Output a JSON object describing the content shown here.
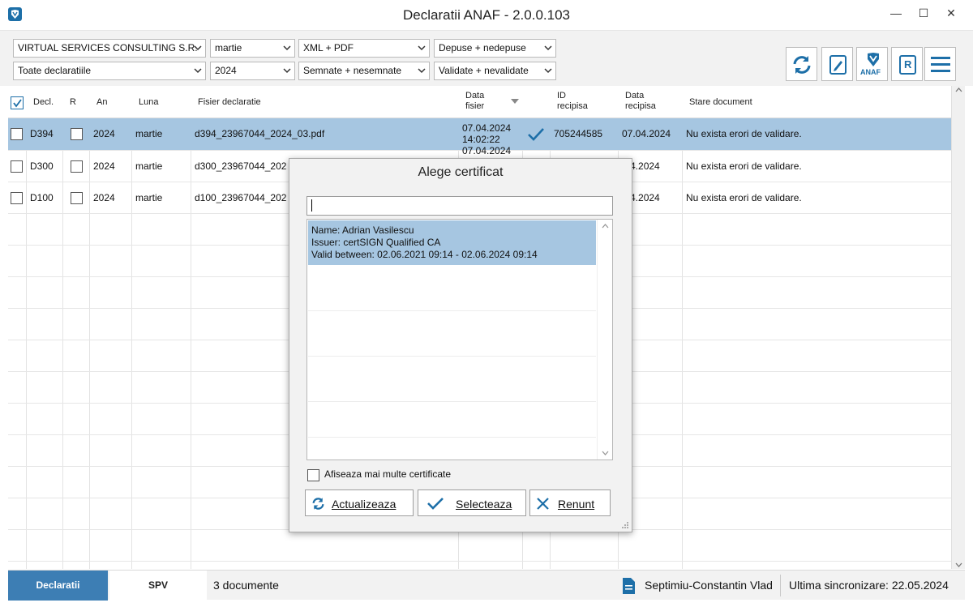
{
  "window": {
    "title": "Declaratii ANAF - 2.0.0.103",
    "minimize": "—",
    "maximize": "☐",
    "close": "✕"
  },
  "filters": {
    "company": "VIRTUAL SERVICES CONSULTING S.R.",
    "month": "martie",
    "format": "XML + PDF",
    "submitted": "Depuse + nedepuse",
    "declarations": "Toate declaratiile",
    "year": "2024",
    "signed": "Semnate + nesemnate",
    "validated": "Validate + nevalidate"
  },
  "toolbar": {
    "anaf_label": "ANAF",
    "r_label": "R"
  },
  "grid": {
    "columns": {
      "decl": "Decl.",
      "r": "R",
      "an": "An",
      "luna": "Luna",
      "fisier": "Fisier declaratie",
      "data_fisier_1": "Data",
      "data_fisier_2": "fisier",
      "id_recipisa_1": "ID",
      "id_recipisa_2": "recipisa",
      "data_recipisa_1": "Data",
      "data_recipisa_2": "recipisa",
      "stare": "Stare document"
    },
    "rows": [
      {
        "decl": "D394",
        "an": "2024",
        "luna": "martie",
        "fisier": "d394_23967044_2024_03.pdf",
        "data_fisier_1": "07.04.2024",
        "data_fisier_2": "14:02:22",
        "id_recipisa": "705244585",
        "data_recipisa": "07.04.2024",
        "stare": "Nu exista erori de validare."
      },
      {
        "decl": "D300",
        "an": "2024",
        "luna": "martie",
        "fisier": "d300_23967044_202",
        "data_fisier_1": "07.04.2024",
        "data_recipisa": ".04.2024",
        "stare": "Nu exista erori de validare."
      },
      {
        "decl": "D100",
        "an": "2024",
        "luna": "martie",
        "fisier": "d100_23967044_202",
        "data_recipisa": ".04.2024",
        "stare": "Nu exista erori de validare."
      }
    ]
  },
  "status": {
    "tab_declaratii": "Declaratii",
    "tab_spv": "SPV",
    "doc_count": "3 documente",
    "user": "Septimiu-Constantin Vlad",
    "sync": "Ultima sincronizare: 22.05.2024"
  },
  "dialog": {
    "title": "Alege certificat",
    "search_value": "",
    "certificate": {
      "name": "Name:  Adrian Vasilescu",
      "issuer": "Issuer: certSIGN Qualified CA",
      "valid": "Valid between: 02.06.2021 09:14 - 02.06.2024 09:14"
    },
    "more_label": "Afiseaza mai multe certificate",
    "refresh_label": "Actualizeaza",
    "select_label": "Selecteaza",
    "cancel_label": "Renunt"
  },
  "colors": {
    "accent": "#1d6fa8",
    "selection": "#a6c6e1",
    "active_tab": "#3d7eb4"
  }
}
